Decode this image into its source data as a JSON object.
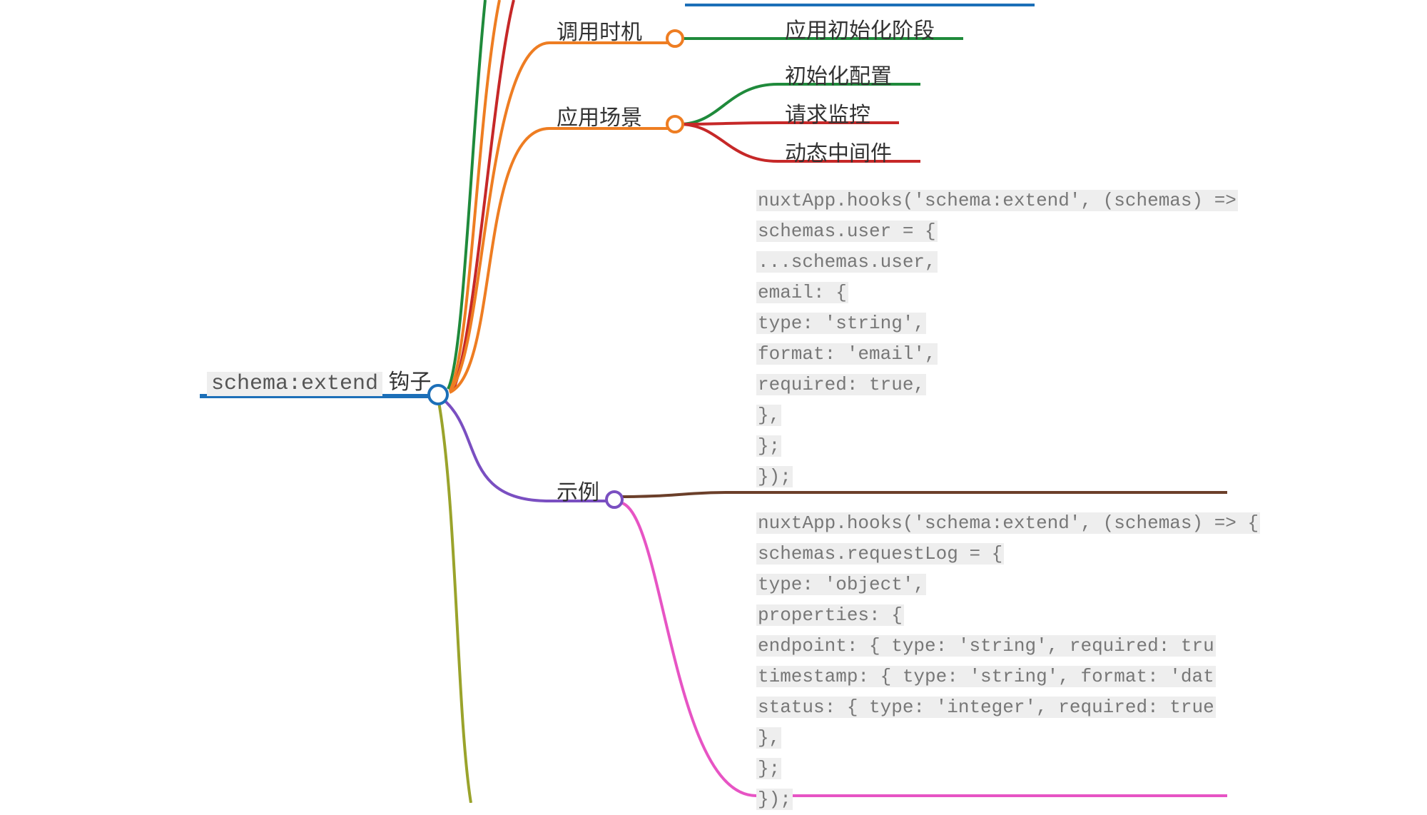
{
  "colors": {
    "blue": "#1c6fb8",
    "orange": "#ee7d22",
    "green": "#1f8a3b",
    "red": "#c62828",
    "purple": "#7a4fc1",
    "brown": "#6b3f2a",
    "magenta": "#e754c4",
    "olive": "#9aa32b"
  },
  "root": {
    "code": "schema:extend",
    "suffix": " 钩子"
  },
  "level2": {
    "timing": "调用时机",
    "scenarios": "应用场景",
    "examples": "示例"
  },
  "leaves": {
    "timing1": "应用初始化阶段",
    "scen1": "初始化配置",
    "scen2": "请求监控",
    "scen3": "动态中间件"
  },
  "code1": {
    "l0": "nuxtApp.hooks('schema:extend', (schemas) =>",
    "l1": "  schemas.user = {",
    "l2": "    ...schemas.user,",
    "l3": "    email: {",
    "l4": "      type: 'string',",
    "l5": "      format: 'email',",
    "l6": "      required: true,",
    "l7": "    },",
    "l8": "  };",
    "l9": "});"
  },
  "code2": {
    "l0": "nuxtApp.hooks('schema:extend', (schemas) => {",
    "l1": "  schemas.requestLog = {",
    "l2": "    type: 'object',",
    "l3": "    properties: {",
    "l4": "      endpoint: { type: 'string', required: tru",
    "l5": "      timestamp: { type: 'string', format: 'dat",
    "l6": "      status: { type: 'integer', required: true",
    "l7": "    },",
    "l8": "  };",
    "l9": "});"
  }
}
